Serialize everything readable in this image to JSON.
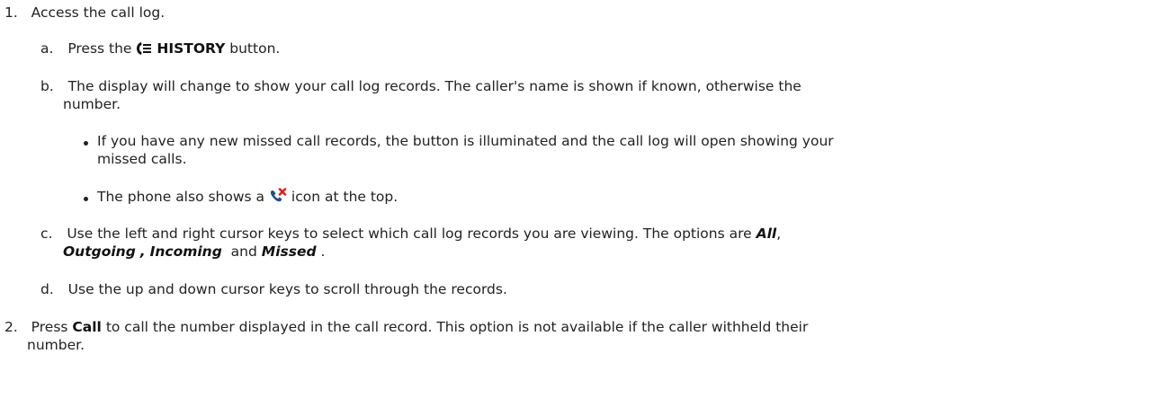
{
  "steps": [
    {
      "number": "1.",
      "text": "Access the call log.",
      "substeps": [
        {
          "letter": "a.",
          "pre": "Press the",
          "button": "HISTORY",
          "post": "button."
        },
        {
          "letter": "b.",
          "line1": "The display will change to show your call log records. The caller's name is shown if known, otherwise the",
          "line2": "number.",
          "bullets": [
            {
              "line1": "If you have any new missed call records, the button is illuminated and the call log will open showing your",
              "line2": "missed calls."
            },
            {
              "pre": "The phone also shows a",
              "post": "icon at the top."
            }
          ]
        },
        {
          "letter": "c.",
          "line1": "Use the left and right cursor keys to select which call log records you are viewing. The options are",
          "opt_all": "All",
          "opt_outgoing": "Outgoing",
          "opt_incoming": "Incoming",
          "and_word": "and",
          "opt_missed": "Missed"
        },
        {
          "letter": "d.",
          "text": "Use the up and down cursor keys to scroll through the records."
        }
      ]
    },
    {
      "number": "2.",
      "pre": "Press",
      "call": "Call",
      "line1_rest": "to call the number displayed in the call record. This option is not available if the caller withheld their",
      "line2": "number."
    }
  ],
  "icons": {
    "history": "history-button-icon",
    "missed": "missed-call-icon"
  },
  "colors": {
    "text": "#222222",
    "missed_icon_phone": "#1f4f8a",
    "missed_icon_x": "#e0201c"
  }
}
